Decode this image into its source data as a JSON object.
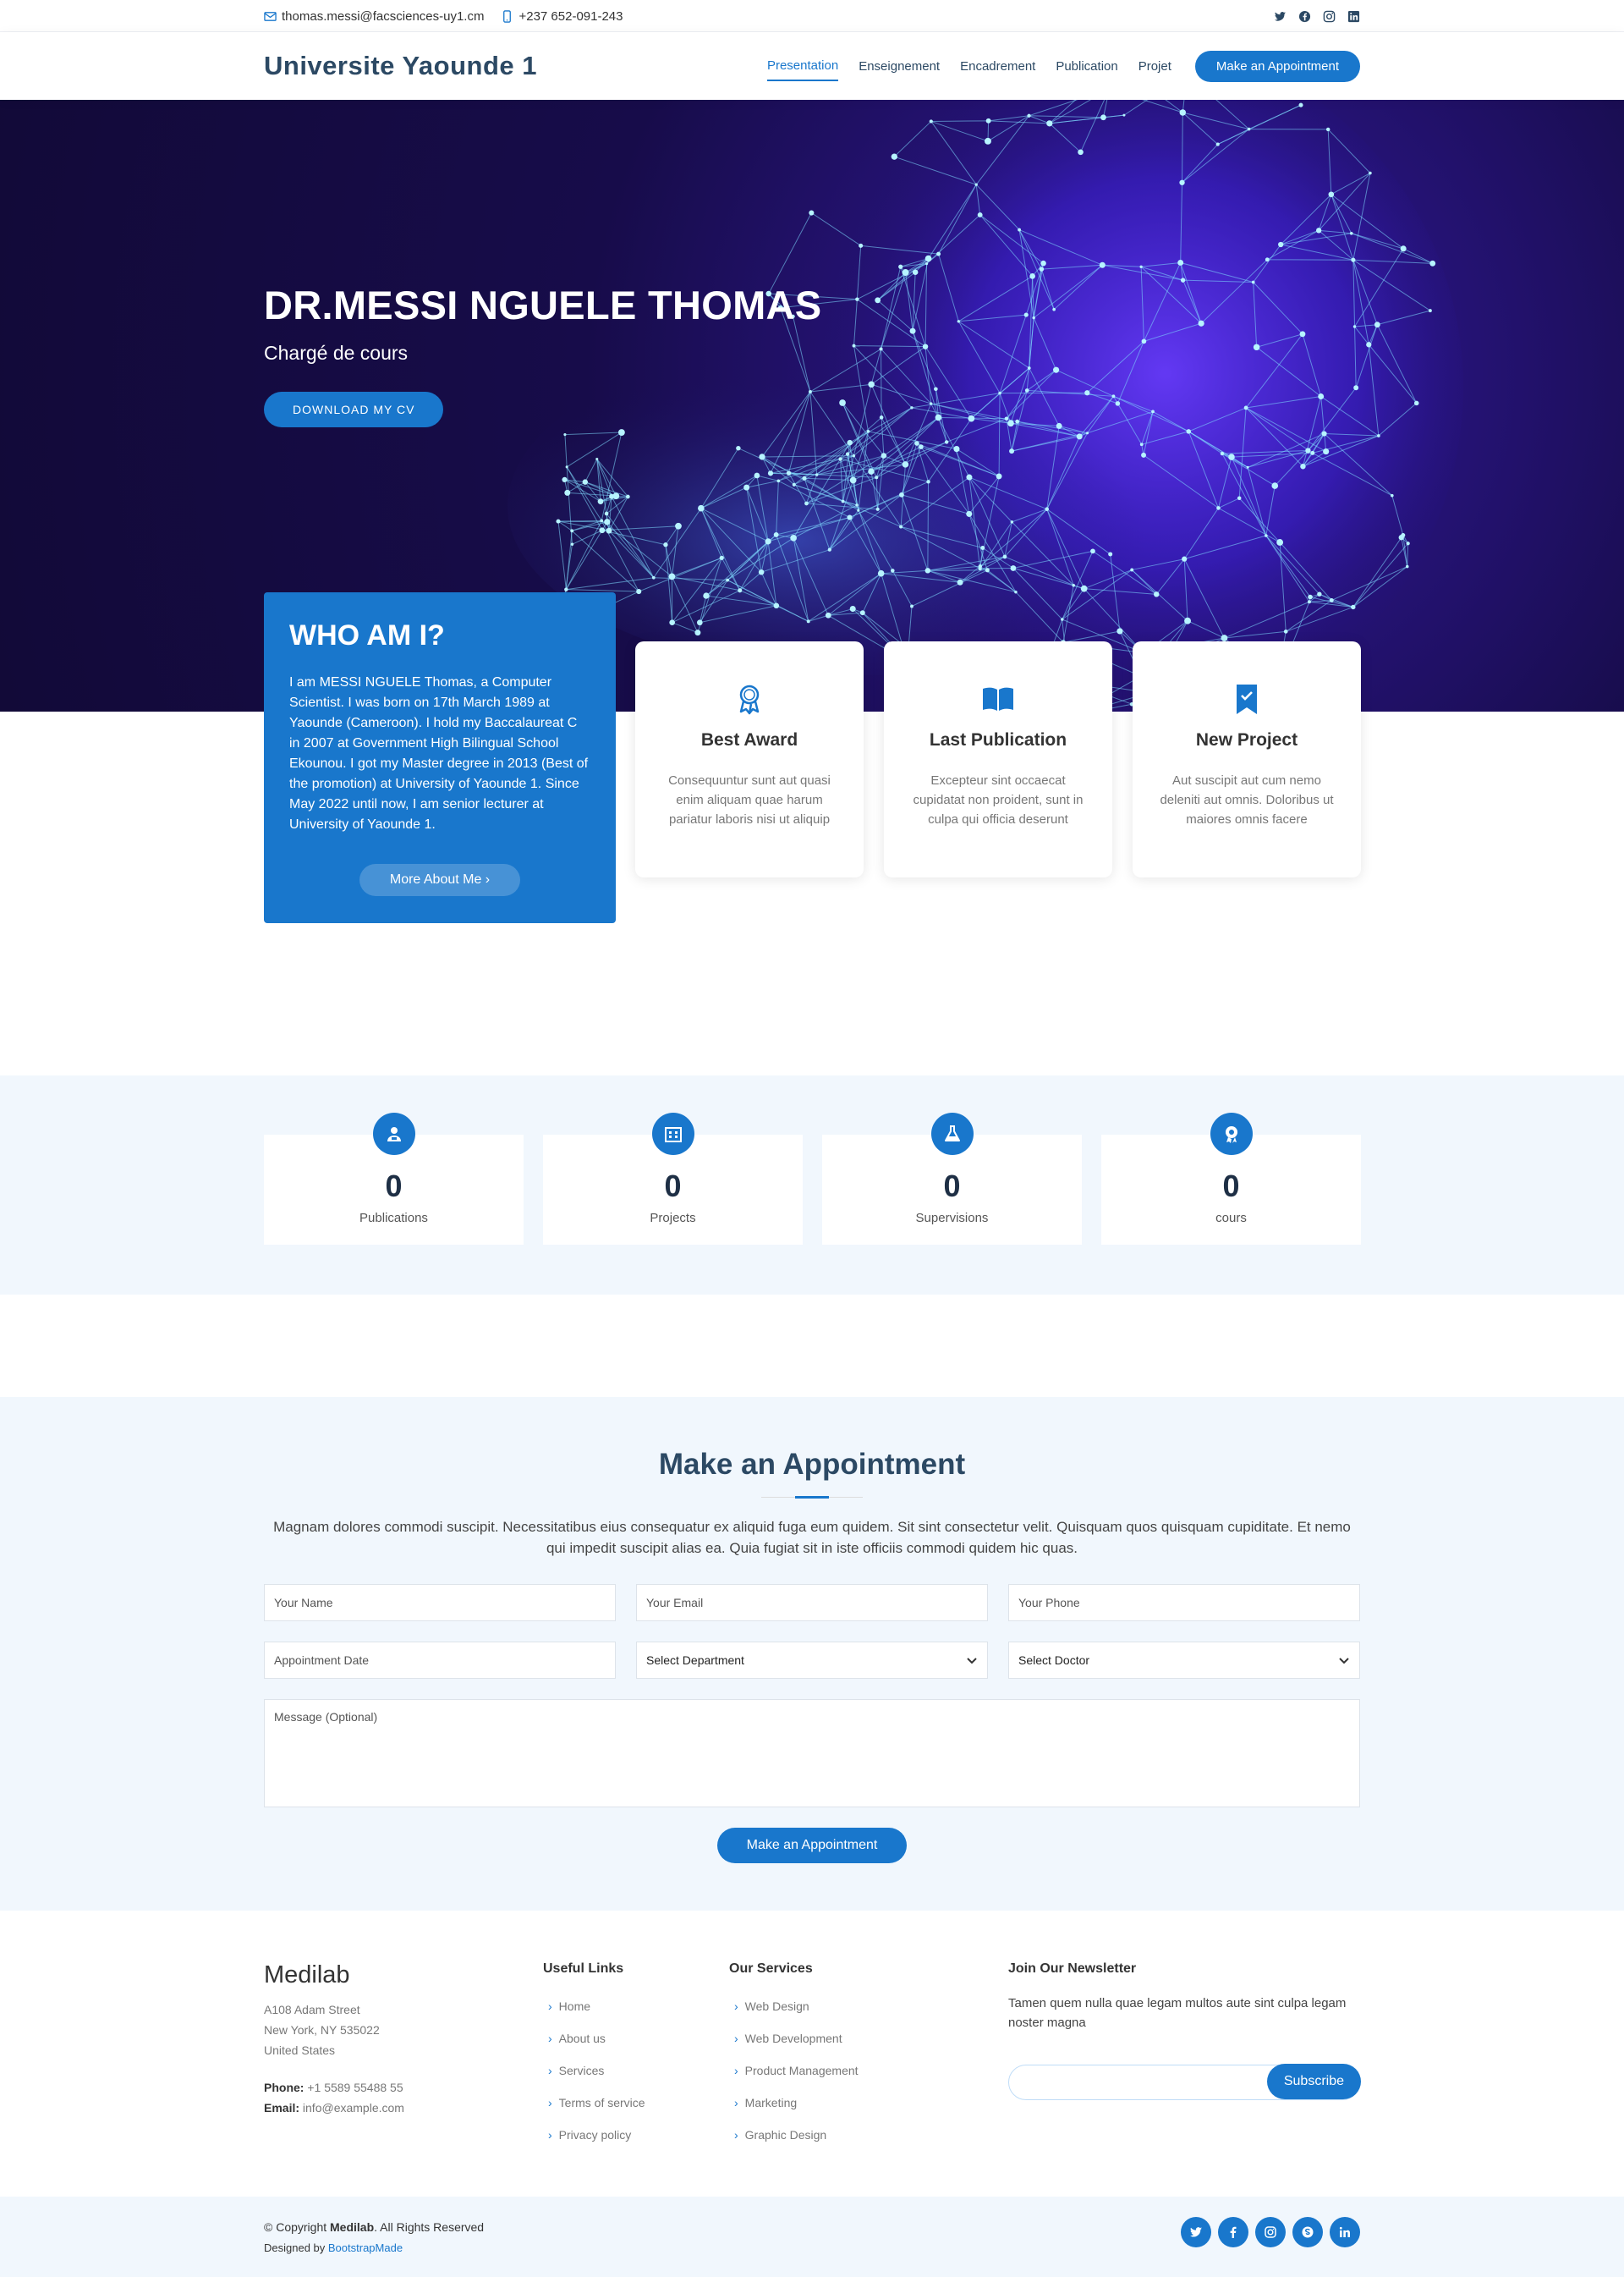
{
  "topbar": {
    "email": "thomas.messi@facsciences-uy1.cm",
    "phone": "+237 652-091-243",
    "socials": [
      "twitter-icon",
      "facebook-icon",
      "instagram-icon",
      "linkedin-icon"
    ]
  },
  "header": {
    "logo": "Universite Yaounde 1",
    "nav": [
      "Presentation",
      "Enseignement",
      "Encadrement",
      "Publication",
      "Projet"
    ],
    "active": "Presentation",
    "appointment_button": "Make an Appointment"
  },
  "hero": {
    "title": "DR.MESSI NGUELE THOMAS",
    "subtitle": "Chargé de cours",
    "cv_button": "DOWNLOAD MY CV"
  },
  "about": {
    "title": "WHO AM I?",
    "text": "I am MESSI NGUELE Thomas, a Computer Scientist. I was born on 17th March 1989 at Yaounde (Cameroon). I hold my Baccalaureat C in 2007 at Government High Bilingual School Ekounou. I got my Master degree in 2013 (Best of the promotion) at University of Yaounde 1. Since May 2022 until now, I am senior lecturer at University of Yaounde 1.",
    "more_button": "More About Me ›"
  },
  "icon_boxes": [
    {
      "icon": "award-icon",
      "title": "Best Award",
      "text": "Consequuntur sunt aut quasi enim aliquam quae harum pariatur laboris nisi ut aliquip"
    },
    {
      "icon": "book-icon",
      "title": "Last Publication",
      "text": "Excepteur sint occaecat cupidatat non proident, sunt in culpa qui officia deserunt"
    },
    {
      "icon": "bookmark-check-icon",
      "title": "New Project",
      "text": "Aut suscipit aut cum nemo deleniti aut omnis. Doloribus ut maiores omnis facere"
    }
  ],
  "counts": [
    {
      "icon": "person-badge-icon",
      "value": "0",
      "label": "Publications"
    },
    {
      "icon": "building-icon",
      "value": "0",
      "label": "Projects"
    },
    {
      "icon": "flask-icon",
      "value": "0",
      "label": "Supervisions"
    },
    {
      "icon": "medal-icon",
      "value": "0",
      "label": "cours"
    }
  ],
  "appointment": {
    "title": "Make an Appointment",
    "description": "Magnam dolores commodi suscipit. Necessitatibus eius consequatur ex aliquid fuga eum quidem. Sit sint consectetur velit. Quisquam quos quisquam cupiditate. Et nemo qui impedit suscipit alias ea. Quia fugiat sit in iste officiis commodi quidem hic quas.",
    "name_placeholder": "Your Name",
    "email_placeholder": "Your Email",
    "phone_placeholder": "Your Phone",
    "date_placeholder": "Appointment Date",
    "department_select": "Select Department",
    "doctor_select": "Select Doctor",
    "message_placeholder": "Message (Optional)",
    "submit": "Make an Appointment"
  },
  "footer": {
    "brand": "Medilab",
    "address1": "A108 Adam Street",
    "address2": "New York, NY 535022",
    "address3": "United States",
    "phone_label": "Phone:",
    "phone": "+1 5589 55488 55",
    "email_label": "Email:",
    "email": "info@example.com",
    "useful_links_title": "Useful Links",
    "useful_links": [
      "Home",
      "About us",
      "Services",
      "Terms of service",
      "Privacy policy"
    ],
    "services_title": "Our Services",
    "services": [
      "Web Design",
      "Web Development",
      "Product Management",
      "Marketing",
      "Graphic Design"
    ],
    "newsletter_title": "Join Our Newsletter",
    "newsletter_text": "Tamen quem nulla quae legam multos aute sint culpa legam noster magna",
    "subscribe": "Subscribe"
  },
  "bottom": {
    "copyright_prefix": "© Copyright ",
    "copyright_brand": "Medilab",
    "copyright_suffix": ". All Rights Reserved",
    "designed_by": "Designed by ",
    "designer": "BootstrapMade",
    "socials": [
      "twitter-icon",
      "facebook-icon",
      "instagram-icon",
      "skype-icon",
      "linkedin-icon"
    ]
  },
  "colors": {
    "accent": "#1977cc",
    "heading": "#2c4964",
    "light_bg": "#f1f7fd",
    "hero_bg": "#170c4a"
  }
}
